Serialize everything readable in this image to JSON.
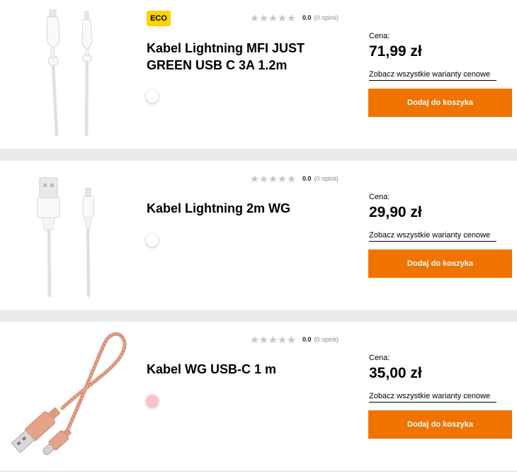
{
  "products": [
    {
      "badge": "ECO",
      "rating_score": "0.0",
      "rating_count": "(0 opinii)",
      "title": "Kabel Lightning MFI JUST GREEN USB C 3A 1.2m",
      "swatch_color": "#ffffff",
      "price_label": "Cena:",
      "price": "71,99 zł",
      "variants_link": "Zobacz wszystkie warianty cenowe",
      "add_button": "Dodaj do koszyka"
    },
    {
      "rating_score": "0.0",
      "rating_count": "(0 opinii)",
      "title": "Kabel Lightning 2m WG",
      "swatch_color": "#ffffff",
      "price_label": "Cena:",
      "price": "29,90 zł",
      "variants_link": "Zobacz wszystkie warianty cenowe",
      "add_button": "Dodaj do koszyka"
    },
    {
      "rating_score": "0.0",
      "rating_count": "(0 opinii)",
      "title": "Kabel WG USB-C 1 m",
      "swatch_color": "#ffc0cb",
      "price_label": "Cena:",
      "price": "35,00 zł",
      "variants_link": "Zobacz wszystkie warianty cenowe",
      "add_button": "Dodaj do koszyka"
    }
  ],
  "colors": {
    "accent": "#f07300",
    "eco_badge": "#ffd200",
    "separator": "#ebebeb",
    "star_empty": "#c8c8c8"
  },
  "icons": {
    "star": "star-icon"
  }
}
